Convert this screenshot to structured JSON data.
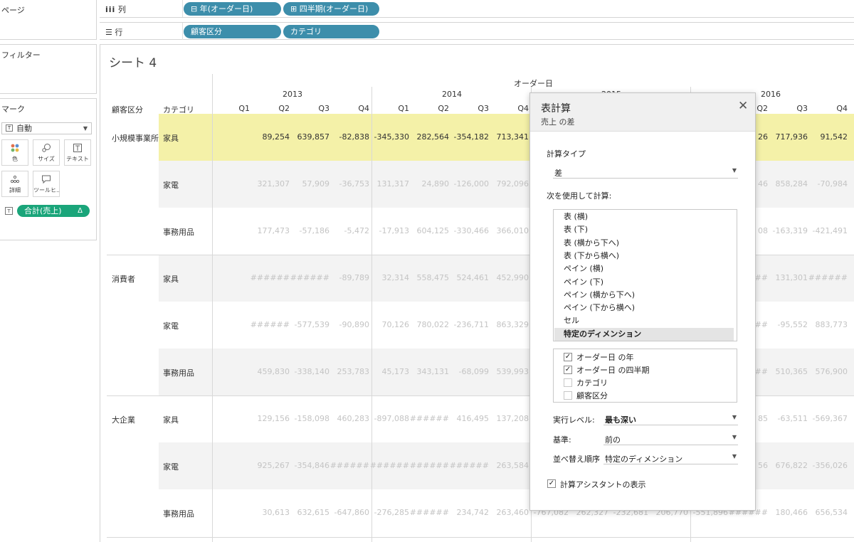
{
  "panels": {
    "pages": "ページ",
    "filters": "フィルター",
    "marks": "マーク"
  },
  "marks": {
    "type_icon": "T",
    "type": "自動",
    "buttons": [
      {
        "icon": "color-icon",
        "label": "色"
      },
      {
        "icon": "size-icon",
        "label": "サイズ"
      },
      {
        "icon": "text-icon",
        "label": "テキスト"
      },
      {
        "icon": "detail-icon",
        "label": "詳細"
      },
      {
        "icon": "tooltip-icon",
        "label": "ツールヒ..."
      }
    ],
    "pill_icon": "T",
    "pill": "合計(売上)",
    "pill_delta": "Δ"
  },
  "shelves": {
    "columns_label": "列",
    "rows_label": "行",
    "column_pills": [
      "⊟ 年(オーダー日)",
      "⊞ 四半期(オーダー日)"
    ],
    "row_pills": [
      "顧客区分",
      "カテゴリ"
    ]
  },
  "sheet": {
    "title": "シート 4",
    "col_group": "オーダー日",
    "row_header_1": "顧客区分",
    "row_header_2": "カテゴリ",
    "years": [
      "2013",
      "2014",
      "2015",
      "2016"
    ],
    "quarters": [
      "Q1",
      "Q2",
      "Q3",
      "Q4"
    ],
    "segments": [
      {
        "name": "小規模事業所",
        "rows": [
          {
            "category": "家具",
            "values": [
              "",
              "89,254",
              "639,857",
              "-82,838",
              "-345,330",
              "282,564",
              "-354,182",
              "713,341",
              "",
              "",
              "",
              "",
              "",
              "26",
              "717,936",
              "91,542"
            ]
          },
          {
            "category": "家電",
            "values": [
              "",
              "321,307",
              "57,909",
              "-36,753",
              "131,317",
              "24,890",
              "-126,000",
              "792,096",
              "",
              "",
              "",
              "",
              "",
              "46",
              "858,284",
              "-70,984"
            ]
          },
          {
            "category": "事務用品",
            "values": [
              "",
              "177,473",
              "-57,186",
              "-5,472",
              "-17,913",
              "604,125",
              "-330,466",
              "366,010",
              "",
              "",
              "",
              "",
              "",
              "08",
              "-163,319",
              "-421,491"
            ]
          }
        ]
      },
      {
        "name": "消費者",
        "rows": [
          {
            "category": "家具",
            "values": [
              "",
              "######",
              "######",
              "-89,789",
              "32,314",
              "558,475",
              "524,461",
              "452,990",
              "",
              "",
              "",
              "",
              "",
              "##",
              "131,301",
              "######"
            ]
          },
          {
            "category": "家電",
            "values": [
              "",
              "######",
              "-577,539",
              "-90,890",
              "70,126",
              "780,022",
              "-236,711",
              "863,329",
              "",
              "",
              "",
              "",
              "",
              "##",
              "-95,552",
              "883,773"
            ]
          },
          {
            "category": "事務用品",
            "values": [
              "",
              "459,830",
              "-338,140",
              "253,783",
              "45,173",
              "343,131",
              "-68,099",
              "539,993",
              "",
              "",
              "",
              "",
              "",
              "##",
              "510,365",
              "576,900"
            ]
          }
        ]
      },
      {
        "name": "大企業",
        "rows": [
          {
            "category": "家具",
            "values": [
              "",
              "129,156",
              "-158,098",
              "460,283",
              "-897,088",
              "######",
              "416,495",
              "137,208",
              "",
              "",
              "",
              "",
              "",
              "85",
              "-63,511",
              "-569,367"
            ]
          },
          {
            "category": "家電",
            "values": [
              "",
              "925,267",
              "-354,846",
              "######",
              "######",
              "######",
              "######",
              "263,584",
              "",
              "",
              "",
              "",
              "",
              "56",
              "676,822",
              "-356,026"
            ]
          },
          {
            "category": "事務用品",
            "values": [
              "",
              "30,613",
              "632,615",
              "-647,860",
              "-276,285",
              "######",
              "234,742",
              "263,460",
              "-767,082",
              "262,327",
              "-232,681",
              "206,770",
              "-551,896",
              "######",
              "180,466",
              "656,534"
            ]
          }
        ]
      }
    ]
  },
  "dialog": {
    "title": "表計算",
    "subtitle": "売上 の差",
    "close_glyph": "✕",
    "calc_type_label": "計算タイプ",
    "calc_type_value": "差",
    "compute_using_label": "次を使用して計算:",
    "compute_options": [
      "表 (横)",
      "表 (下)",
      "表 (横から下へ)",
      "表 (下から横へ)",
      "ペイン (横)",
      "ペイン (下)",
      "ペイン (横から下へ)",
      "ペイン (下から横へ)",
      "セル",
      "特定のディメンション"
    ],
    "selected_option": "特定のディメンション",
    "dimensions": [
      {
        "label": "オーダー日 の年",
        "checked": true
      },
      {
        "label": "オーダー日 の四半期",
        "checked": true
      },
      {
        "label": "カテゴリ",
        "checked": false
      },
      {
        "label": "顧客区分",
        "checked": false
      }
    ],
    "check_glyph": "✓",
    "level_label": "実行レベル:",
    "level_value": "最も深い",
    "relative_label": "基準:",
    "relative_value": "前の",
    "sort_label": "並べ替え順序",
    "sort_value": "特定のディメンション",
    "assistant_label": "計算アシスタントの表示",
    "assistant_checked": true
  },
  "colors": {
    "highlight_row": "#f4f1a8",
    "alt_row": "#f3f3f3",
    "blue_pill": "#3d8eab",
    "green_pill": "#1aa57a"
  }
}
